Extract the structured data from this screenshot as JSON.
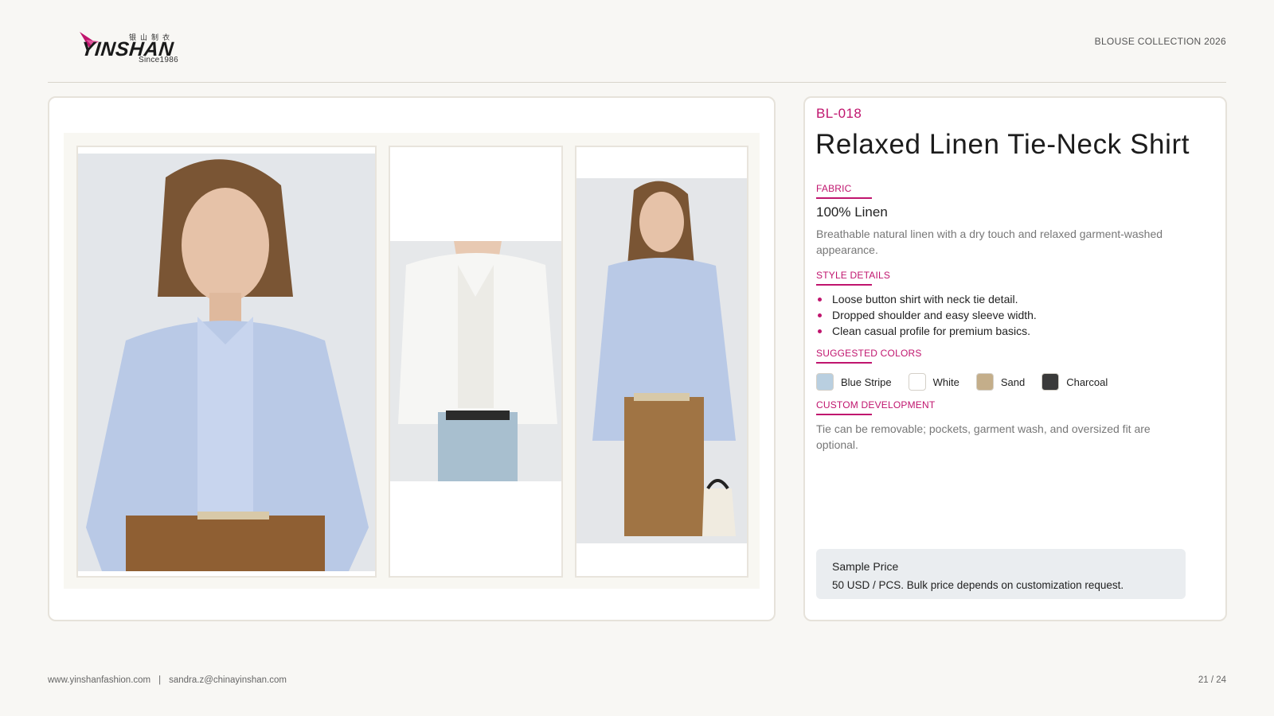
{
  "header": {
    "logo_chinese": "银山制衣",
    "logo_word": "YINSHAN",
    "logo_since": "Since1986",
    "collection": "BLOUSE COLLECTION 2026"
  },
  "gallery": {
    "photos": [
      {
        "name": "front-view-photo"
      },
      {
        "name": "tied-front-photo"
      },
      {
        "name": "full-body-photo"
      }
    ]
  },
  "product": {
    "code": "BL-018",
    "title": "Relaxed Linen Tie-Neck Shirt",
    "fabric": {
      "label": "FABRIC",
      "value": "100% Linen",
      "description": "Breathable natural linen with a dry touch and relaxed garment-washed appearance."
    },
    "style": {
      "label": "STYLE DETAILS",
      "items": [
        "Loose button shirt with neck tie detail.",
        "Dropped shoulder and easy sleeve width.",
        "Clean casual profile for premium basics."
      ]
    },
    "colors": {
      "label": "SUGGESTED COLORS",
      "items": [
        {
          "name": "Blue Stripe",
          "hex": "#b9cfe0"
        },
        {
          "name": "White",
          "hex": "#ffffff"
        },
        {
          "name": "Sand",
          "hex": "#c4ae8a"
        },
        {
          "name": "Charcoal",
          "hex": "#3a3a3a"
        }
      ]
    },
    "custom": {
      "label": "CUSTOM DEVELOPMENT",
      "text": "Tie can be removable; pockets, garment wash, and oversized fit are optional."
    },
    "price": {
      "title": "Sample Price",
      "text": "50 USD / PCS. Bulk price depends on customization request."
    }
  },
  "footer": {
    "website": "www.yinshanfashion.com",
    "separator": "|",
    "email": "sandra.z@chinayinshan.com",
    "page": "21 / 24"
  },
  "theme": {
    "accent": "#c0156e",
    "background": "#f8f7f4"
  }
}
